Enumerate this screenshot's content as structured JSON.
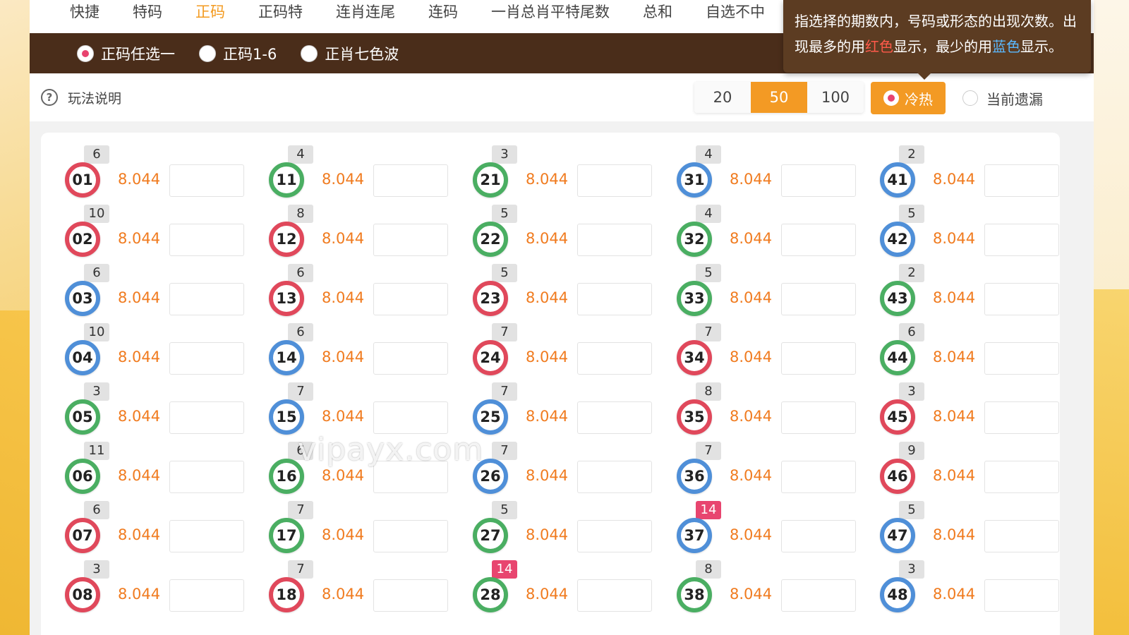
{
  "top_tabs": [
    "快捷",
    "特码",
    "正码",
    "正码特",
    "连肖连尾",
    "连码",
    "一肖总肖平特尾数",
    "总和",
    "自选不中"
  ],
  "active_tab": "正码",
  "sub_options": [
    {
      "label": "正码任选一",
      "selected": true
    },
    {
      "label": "正码1-6",
      "selected": false
    },
    {
      "label": "正肖七色波",
      "selected": false
    }
  ],
  "tooltip": {
    "line1": "指选择的期数内，号码或形态的出现次数。出",
    "line2_a": "现最多的用",
    "line2_red": "红色",
    "line2_b": "显示，最少的用",
    "line2_blue": "蓝色",
    "line2_c": "显示。"
  },
  "help_label": "玩法说明",
  "periods": [
    "20",
    "50",
    "100"
  ],
  "active_period": "50",
  "mode_hot_label": "冷热",
  "mode_miss_label": "当前遗漏",
  "colors": {
    "red": "#e0485b",
    "green": "#4aae62",
    "blue": "#4f8fd8",
    "accent": "#f39a24",
    "hot_badge": "#e8456f"
  },
  "watermark": "vipayx.com",
  "numbers": [
    {
      "num": "01",
      "color": "red",
      "count": "6",
      "odds": "8.044"
    },
    {
      "num": "02",
      "color": "red",
      "count": "10",
      "odds": "8.044"
    },
    {
      "num": "03",
      "color": "blue",
      "count": "6",
      "odds": "8.044"
    },
    {
      "num": "04",
      "color": "blue",
      "count": "10",
      "odds": "8.044"
    },
    {
      "num": "05",
      "color": "green",
      "count": "3",
      "odds": "8.044"
    },
    {
      "num": "06",
      "color": "green",
      "count": "11",
      "odds": "8.044"
    },
    {
      "num": "07",
      "color": "red",
      "count": "6",
      "odds": "8.044"
    },
    {
      "num": "08",
      "color": "red",
      "count": "3",
      "odds": "8.044"
    },
    {
      "num": "11",
      "color": "green",
      "count": "4",
      "odds": "8.044"
    },
    {
      "num": "12",
      "color": "red",
      "count": "8",
      "odds": "8.044"
    },
    {
      "num": "13",
      "color": "red",
      "count": "6",
      "odds": "8.044"
    },
    {
      "num": "14",
      "color": "blue",
      "count": "6",
      "odds": "8.044"
    },
    {
      "num": "15",
      "color": "blue",
      "count": "7",
      "odds": "8.044"
    },
    {
      "num": "16",
      "color": "green",
      "count": "6",
      "odds": "8.044"
    },
    {
      "num": "17",
      "color": "green",
      "count": "7",
      "odds": "8.044"
    },
    {
      "num": "18",
      "color": "red",
      "count": "7",
      "odds": "8.044"
    },
    {
      "num": "21",
      "color": "green",
      "count": "3",
      "odds": "8.044"
    },
    {
      "num": "22",
      "color": "green",
      "count": "5",
      "odds": "8.044"
    },
    {
      "num": "23",
      "color": "red",
      "count": "5",
      "odds": "8.044"
    },
    {
      "num": "24",
      "color": "red",
      "count": "7",
      "odds": "8.044"
    },
    {
      "num": "25",
      "color": "blue",
      "count": "7",
      "odds": "8.044"
    },
    {
      "num": "26",
      "color": "blue",
      "count": "7",
      "odds": "8.044"
    },
    {
      "num": "27",
      "color": "green",
      "count": "5",
      "odds": "8.044"
    },
    {
      "num": "28",
      "color": "green",
      "count": "14",
      "odds": "8.044",
      "hot": true
    },
    {
      "num": "31",
      "color": "blue",
      "count": "4",
      "odds": "8.044"
    },
    {
      "num": "32",
      "color": "green",
      "count": "4",
      "odds": "8.044"
    },
    {
      "num": "33",
      "color": "green",
      "count": "5",
      "odds": "8.044"
    },
    {
      "num": "34",
      "color": "red",
      "count": "7",
      "odds": "8.044"
    },
    {
      "num": "35",
      "color": "red",
      "count": "8",
      "odds": "8.044"
    },
    {
      "num": "36",
      "color": "blue",
      "count": "7",
      "odds": "8.044"
    },
    {
      "num": "37",
      "color": "blue",
      "count": "14",
      "odds": "8.044",
      "hot": true
    },
    {
      "num": "38",
      "color": "green",
      "count": "8",
      "odds": "8.044"
    },
    {
      "num": "41",
      "color": "blue",
      "count": "2",
      "odds": "8.044"
    },
    {
      "num": "42",
      "color": "blue",
      "count": "5",
      "odds": "8.044"
    },
    {
      "num": "43",
      "color": "green",
      "count": "2",
      "odds": "8.044"
    },
    {
      "num": "44",
      "color": "green",
      "count": "6",
      "odds": "8.044"
    },
    {
      "num": "45",
      "color": "red",
      "count": "3",
      "odds": "8.044"
    },
    {
      "num": "46",
      "color": "red",
      "count": "9",
      "odds": "8.044"
    },
    {
      "num": "47",
      "color": "blue",
      "count": "5",
      "odds": "8.044"
    },
    {
      "num": "48",
      "color": "blue",
      "count": "3",
      "odds": "8.044"
    }
  ]
}
